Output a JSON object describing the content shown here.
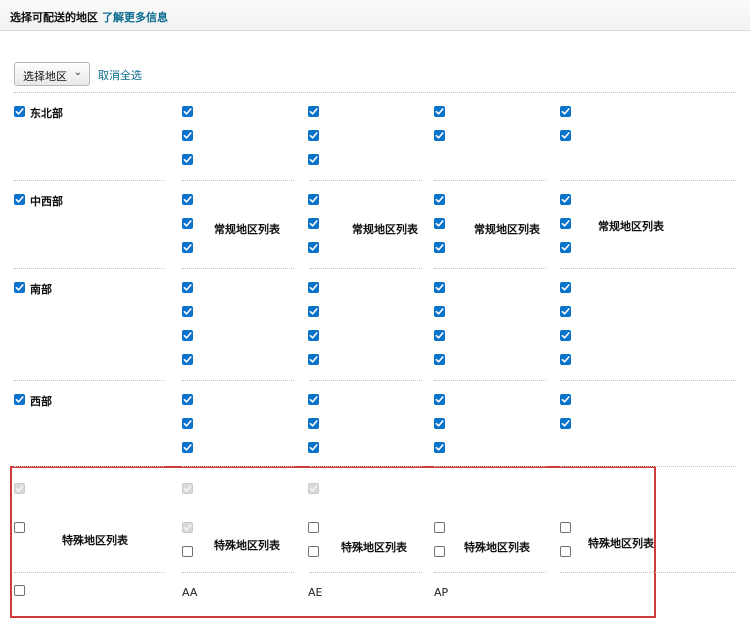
{
  "header": {
    "title": "选择可配送的地区",
    "learn_more": "了解更多信息"
  },
  "toolbar": {
    "select_region_label": "选择地区",
    "deselect_all_label": "取消全选"
  },
  "regions": [
    {
      "name": "东北部",
      "checked": true
    },
    {
      "name": "中西部",
      "checked": true
    },
    {
      "name": "南部",
      "checked": true
    },
    {
      "name": "西部",
      "checked": true
    }
  ],
  "regular_list_label": "常规地区列表",
  "special_list_label": "特殊地区列表",
  "special_codes": [
    "AA",
    "AE",
    "AP"
  ],
  "colors": {
    "accent": "#0a72c9",
    "link": "#0b6b8f",
    "highlight_border": "#d03a3a"
  }
}
